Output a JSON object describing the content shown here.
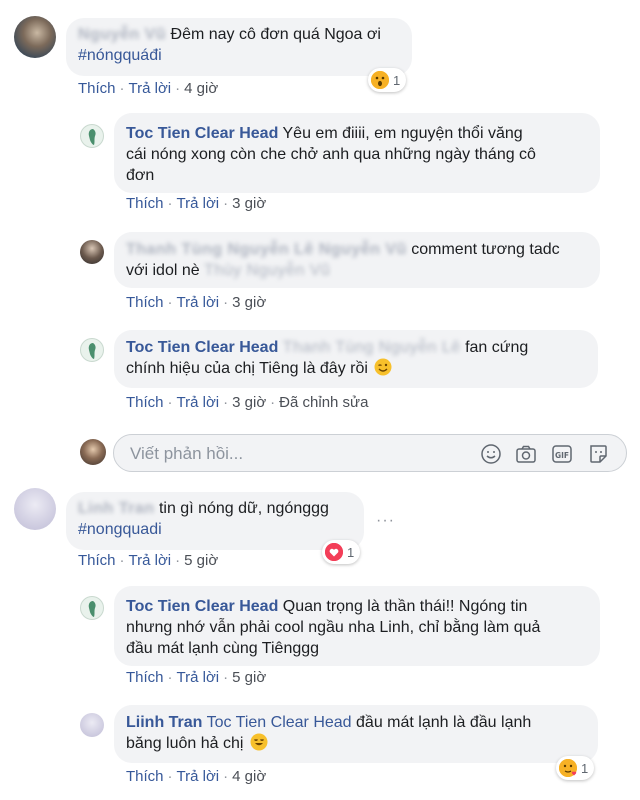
{
  "comments": [
    {
      "author": "Nguyễn Vũ",
      "text": "Đêm nay cô đơn quá Ngoa ơi",
      "hashtag": "#nóngquáđi",
      "like": "Thích",
      "reply": "Trả lời",
      "time": "4 giờ",
      "reaction": {
        "icon": "wow-emoji-icon",
        "count": "1"
      },
      "replies": [
        {
          "author": "Toc Tien Clear Head",
          "line1": "Yêu em điiii, em nguyện thổi văng",
          "line2": "cái nóng xong còn che chở anh qua những ngày tháng cô",
          "line3": "đơn",
          "like": "Thích",
          "reply": "Trả lời",
          "time": "3 giờ"
        },
        {
          "author": "Thanh Tùng Nguyễn Lê Nguyễn Vũ",
          "line1": "comment tương tadc",
          "line2a": "với idol nè",
          "mention": "Thùy Nguyễn Vũ",
          "like": "Thích",
          "reply": "Trả lời",
          "time": "3 giờ"
        },
        {
          "author": "Toc Tien Clear Head",
          "mention": "Thanh Tùng Nguyễn Lê",
          "line1": "fan cứng",
          "line2": "chính hiệu của chị Tiêng là đây rồi",
          "like": "Thích",
          "reply": "Trả lời",
          "time": "3 giờ",
          "edited": "Đã chỉnh sửa"
        }
      ],
      "reply_box_placeholder": "Viết phản hồi..."
    },
    {
      "author": "Linh Tran",
      "text": "tin gì nóng dữ, ngónggg",
      "hashtag": "#nongquadi",
      "more": "···",
      "like": "Thích",
      "reply": "Trả lời",
      "time": "5 giờ",
      "reaction": {
        "icon": "love-heart-icon",
        "count": "1"
      },
      "replies": [
        {
          "author": "Toc Tien Clear Head",
          "line1": "Quan trọng là thần thái!! Ngóng tin",
          "line2": "nhưng nhớ vẫn phải cool ngầu nha Linh, chỉ bằng làm quả",
          "line3": "đầu mát lạnh cùng Tiênggg",
          "like": "Thích",
          "reply": "Trả lời",
          "time": "5 giờ"
        },
        {
          "author": "Liinh Tran",
          "mention": "Toc Tien Clear Head",
          "line1": "đầu mát lạnh là đầu lạnh",
          "line2": "băng luôn hả chị",
          "like": "Thích",
          "reply": "Trả lời",
          "time": "4 giờ",
          "reaction": {
            "icon": "care-emoji-icon",
            "count": "1"
          }
        }
      ]
    }
  ],
  "colors": {
    "link": "#385898",
    "bubble": "#f2f3f5",
    "heart": "#f33e58",
    "wow": "#f7b125"
  }
}
